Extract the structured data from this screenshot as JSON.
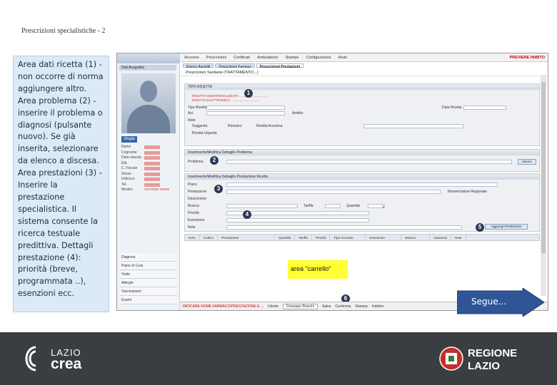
{
  "slide": {
    "title": "Prescrizioni specialistiche - 2",
    "description": "Area dati ricetta (1) - non occorre di norma aggiungere altro. Area problema (2) - inserire il problema o diagnosi (pulsante nuovo). Se già inserita, selezionare da elenco a discesa. Area prestazioni (3) - Inserire la prestazione specialistica. Il sistema consente la ricerca testuale predittiva. Dettagli prestazione (4): priorità (breve, programmata ..), esenzioni ecc.",
    "next_label": "Segue..."
  },
  "screenshot": {
    "left_panel": {
      "tab": "Dati Anagrafici",
      "browse_button": "Sfoglia",
      "fields": [
        "Nome",
        "Cognome",
        "Data nascita",
        "Età",
        "C. Fiscale",
        "Sesso",
        "Indirizzo",
        "Tel.",
        "Medico"
      ],
      "doctor_value": "ANTONIO VERDI",
      "menu": [
        "Diagnosi",
        "Piano di Cura",
        "Visite",
        "Allergie",
        "Vaccinazioni",
        "Esami"
      ]
    },
    "menubar": [
      "Accesso",
      "Prescrizioni",
      "Certificati",
      "Ambulatorio",
      "Stampe",
      "Configurazioni",
      "Aiuto"
    ],
    "menubar_right": "PREVIENE INIBITO",
    "tabs": [
      "Elenco Assistiti",
      "Prescrizioni Farmaci",
      "Prescrizioni Prestazioni"
    ],
    "breadcrumb": "Prescrizioni Sanitarie (TRATTAMENTO...)",
    "sections": {
      "recipe_header": "TIPO RICETTA",
      "problem_header": "Inserimento/Modifica Dettaglio Problema",
      "service_header": "Inserimento/Modifica Dettaglio Prestazione Ricetta",
      "problem_label": "Problema",
      "new_button": "Nuovo",
      "service_labels": [
        "Piano",
        "Prestazione",
        "Descrizione",
        "Branca",
        "Priorità",
        "Esenzione",
        "Note"
      ],
      "tariff_label": "Tariffa",
      "quantity_label": "Quantità",
      "quantity_value": "1",
      "recipe_labels": [
        "Tipo Ricetta",
        "Asl",
        "Note",
        "Ambito",
        "Data Ricetta"
      ],
      "checkboxes": [
        "Suggerita",
        "Ricovero",
        "Ricetta Anonima",
        "Ricetta Urgente"
      ],
      "add_button": "Aggiungi Prestazione",
      "catalog_label": "Nomenclatore Regionale",
      "grid_headers": [
        "DAC",
        "Codice",
        "Prestazione",
        "Quantità",
        "Tariffa",
        "Priorità",
        "Tipo Accesso",
        "Esenzione",
        "Branca",
        "Garanzia",
        "Note"
      ]
    },
    "cart_label": "area \"carrello\"",
    "bottom": {
      "warning": "INDICARE NOME FARMACO/PRESTAZIONE E ...",
      "user_label": "Utente",
      "user_value": "Giuseppe Bianchi",
      "buttons": [
        "Salva",
        "Conferma",
        "Stampa",
        "Indietro"
      ]
    },
    "markers": [
      "1",
      "2",
      "3",
      "4",
      "5",
      "6"
    ]
  },
  "footer": {
    "left_logo_line1": "LAZIO",
    "left_logo_line2": "crea",
    "right_logo_line1": "REGIONE",
    "right_logo_line2": "LAZIO"
  },
  "colors": {
    "side_box_bg": "#dce9f7",
    "footer_bg": "#3a3e43",
    "cart_bg": "#ffff33",
    "marker_bg": "#2b3a55",
    "next_arrow": "#2f5597"
  }
}
